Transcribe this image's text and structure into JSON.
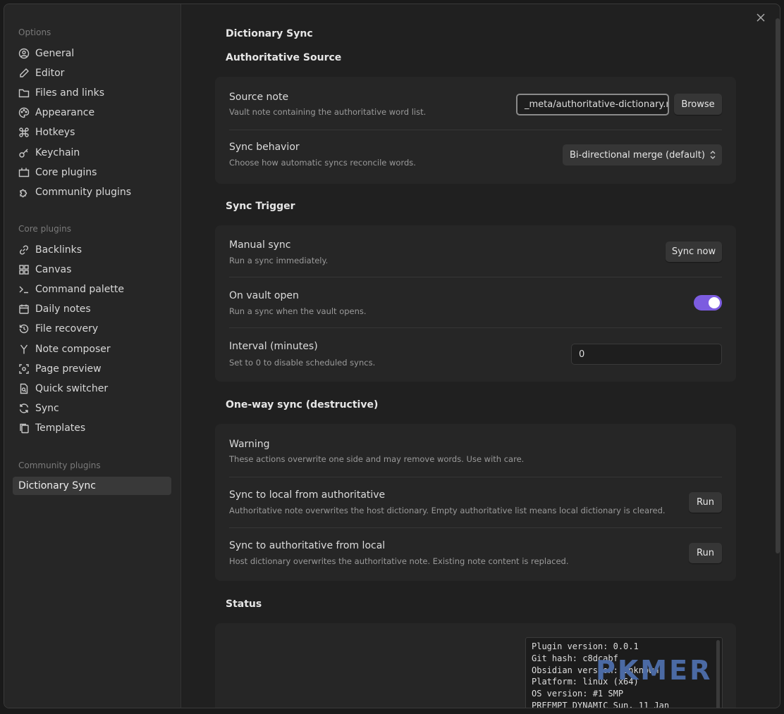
{
  "sidebar": {
    "options_title": "Options",
    "options": [
      {
        "label": "General",
        "icon": "gear-circle-icon"
      },
      {
        "label": "Editor",
        "icon": "pencil-icon"
      },
      {
        "label": "Files and links",
        "icon": "folder-icon"
      },
      {
        "label": "Appearance",
        "icon": "palette-icon"
      },
      {
        "label": "Hotkeys",
        "icon": "command-icon"
      },
      {
        "label": "Keychain",
        "icon": "key-icon"
      },
      {
        "label": "Core plugins",
        "icon": "plug-icon"
      },
      {
        "label": "Community plugins",
        "icon": "puzzle-icon"
      }
    ],
    "core_title": "Core plugins",
    "core": [
      {
        "label": "Backlinks",
        "icon": "link-icon"
      },
      {
        "label": "Canvas",
        "icon": "canvas-icon"
      },
      {
        "label": "Command palette",
        "icon": "terminal-icon"
      },
      {
        "label": "Daily notes",
        "icon": "calendar-icon"
      },
      {
        "label": "File recovery",
        "icon": "history-icon"
      },
      {
        "label": "Note composer",
        "icon": "merge-icon"
      },
      {
        "label": "Page preview",
        "icon": "preview-icon"
      },
      {
        "label": "Quick switcher",
        "icon": "file-search-icon"
      },
      {
        "label": "Sync",
        "icon": "sync-icon"
      },
      {
        "label": "Templates",
        "icon": "files-icon"
      }
    ],
    "community_title": "Community plugins",
    "community": [
      {
        "label": "Dictionary Sync",
        "active": true
      }
    ]
  },
  "main": {
    "page_title": "Dictionary Sync",
    "authoritative": {
      "heading": "Authoritative Source",
      "source_note_name": "Source note",
      "source_note_desc": "Vault note containing the authoritative word list.",
      "source_note_value": "_meta/authoritative-dictionary.n",
      "browse_label": "Browse",
      "sync_behavior_name": "Sync behavior",
      "sync_behavior_desc": "Choose how automatic syncs reconcile words.",
      "sync_behavior_value": "Bi-directional merge (default)"
    },
    "trigger": {
      "heading": "Sync Trigger",
      "manual_name": "Manual sync",
      "manual_desc": "Run a sync immediately.",
      "sync_now_label": "Sync now",
      "vault_open_name": "On vault open",
      "vault_open_desc": "Run a sync when the vault opens.",
      "vault_open_enabled": true,
      "interval_name": "Interval (minutes)",
      "interval_desc": "Set to 0 to disable scheduled syncs.",
      "interval_value": "0"
    },
    "oneway": {
      "heading": "One-way sync (destructive)",
      "warning_name": "Warning",
      "warning_desc": "These actions overwrite one side and may remove words. Use with care.",
      "to_local_name": "Sync to local from authoritative",
      "to_local_desc": "Authoritative note overwrites the host dictionary. Empty authoritative list means local dictionary is cleared.",
      "to_local_button": "Run",
      "to_auth_name": "Sync to authoritative from local",
      "to_auth_desc": "Host dictionary overwrites the authoritative note. Existing note content is replaced.",
      "to_auth_button": "Run"
    },
    "status": {
      "heading": "Status",
      "lines": [
        "Plugin version: 0.0.1",
        "Git hash: c8dcabf",
        "Obsidian version: unknown",
        "Platform: linux (x64)",
        "OS version: #1 SMP",
        "PREEMPT_DYNAMIC Sun, 11 Jan"
      ]
    }
  },
  "watermark": "PKMER",
  "colors": {
    "accent": "#7c5ce0",
    "background": "#202020",
    "sidebar": "#262626"
  }
}
